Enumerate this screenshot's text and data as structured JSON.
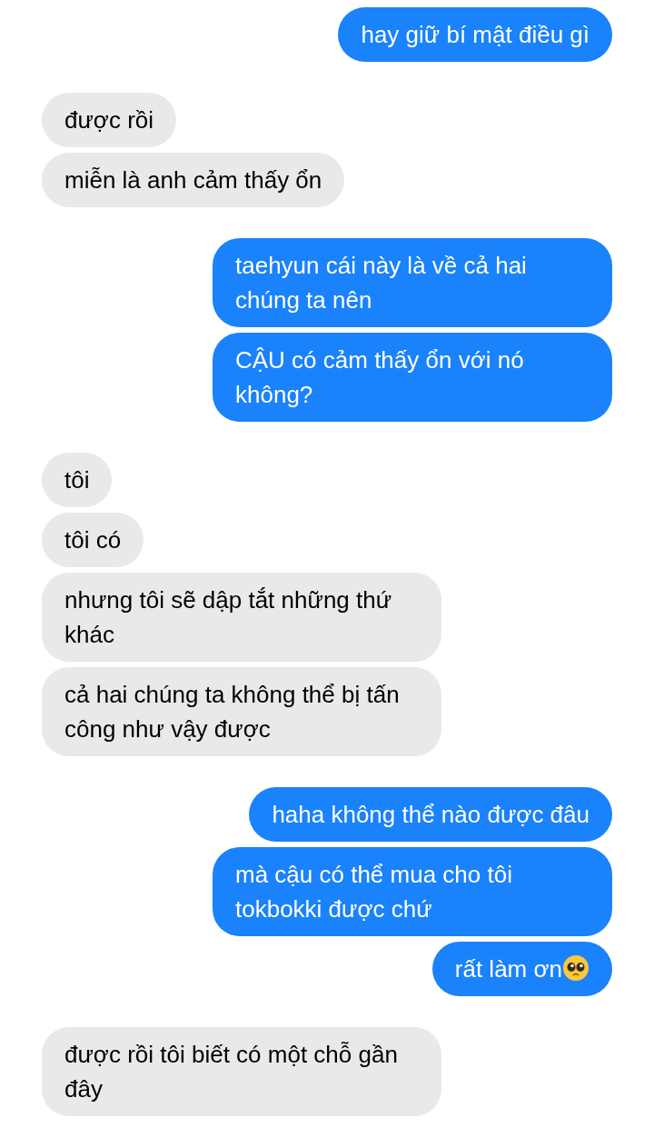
{
  "groups": [
    {
      "kind": "sent",
      "messages": [
        {
          "text": "hay giữ bí mật điều gì"
        }
      ]
    },
    {
      "kind": "received",
      "messages": [
        {
          "text": "được rồi"
        },
        {
          "text": "miễn là anh cảm thấy ổn"
        }
      ]
    },
    {
      "kind": "sent",
      "messages": [
        {
          "text": "taehyun cái này là về cả hai chúng ta nên"
        },
        {
          "text": "CẬU có cảm thấy ổn với nó không?"
        }
      ]
    },
    {
      "kind": "received",
      "messages": [
        {
          "text": "tôi"
        },
        {
          "text": "tôi có"
        },
        {
          "text": "nhưng tôi sẽ dập tắt những thứ khác"
        },
        {
          "text": "cả hai chúng ta không thể bị tấn công như vậy được"
        }
      ]
    },
    {
      "kind": "sent",
      "messages": [
        {
          "text": "haha không thể nào được đâu"
        },
        {
          "text": "mà cậu có thể mua cho tôi tokbokki được chứ"
        },
        {
          "text": "rất làm ơn",
          "emoji": true
        }
      ]
    },
    {
      "kind": "received",
      "messages": [
        {
          "text": "được rồi tôi biết có một chỗ gần đây"
        }
      ]
    }
  ]
}
